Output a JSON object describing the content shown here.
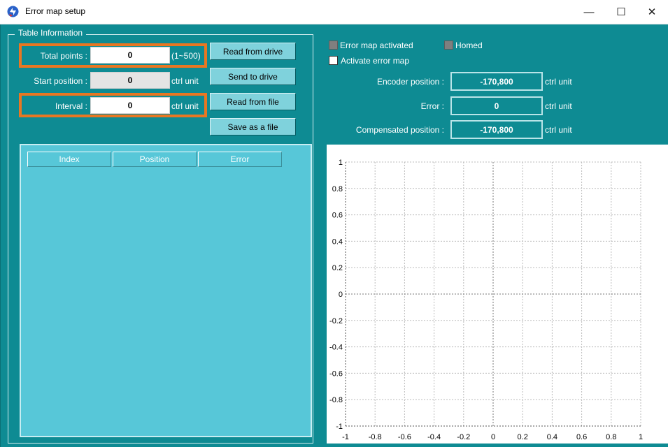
{
  "window": {
    "title": "Error map setup",
    "minimize": "—",
    "maximize": "☐",
    "close": "✕"
  },
  "table_info": {
    "legend": "Table Information",
    "total_points_label": "Total points :",
    "total_points_value": "0",
    "total_points_range": "(1~500)",
    "start_position_label": "Start position :",
    "start_position_value": "0",
    "start_position_unit": "ctrl unit",
    "interval_label": "Interval :",
    "interval_value": "0",
    "interval_unit": "ctrl unit"
  },
  "buttons": {
    "read_from_drive": "Read from drive",
    "send_to_drive": "Send to drive",
    "read_from_file": "Read from file",
    "save_as_file": "Save as a file"
  },
  "table": {
    "columns": [
      "Index",
      "Position",
      "Error"
    ]
  },
  "status": {
    "error_map_activated": "Error map activated",
    "homed": "Homed",
    "activate_error_map": "Activate error map",
    "led_color": "#7f7f7f"
  },
  "readouts": {
    "encoder_label": "Encoder position :",
    "encoder_value": "-170,800",
    "encoder_unit": "ctrl unit",
    "error_label": "Error :",
    "error_value": "0",
    "error_unit": "ctrl unit",
    "compensated_label": "Compensated position :",
    "compensated_value": "-170,800",
    "compensated_unit": "ctrl unit"
  },
  "colors": {
    "background": "#0e8b93",
    "table_panel": "#57c7d8",
    "highlight": "#e87722",
    "button": "#7fd2dc"
  },
  "chart_data": {
    "type": "line",
    "series": [],
    "xlim": [
      -1,
      1
    ],
    "ylim": [
      -1,
      1
    ],
    "x_ticks": [
      "-1",
      "-0.8",
      "-0.6",
      "-0.4",
      "-0.2",
      "0",
      "0.2",
      "0.4",
      "0.6",
      "0.8",
      "1"
    ],
    "y_ticks": [
      "1",
      "0.8",
      "0.6",
      "0.4",
      "0.2",
      "0",
      "-0.2",
      "-0.4",
      "-0.6",
      "-0.8",
      "-1"
    ],
    "grid": true
  }
}
